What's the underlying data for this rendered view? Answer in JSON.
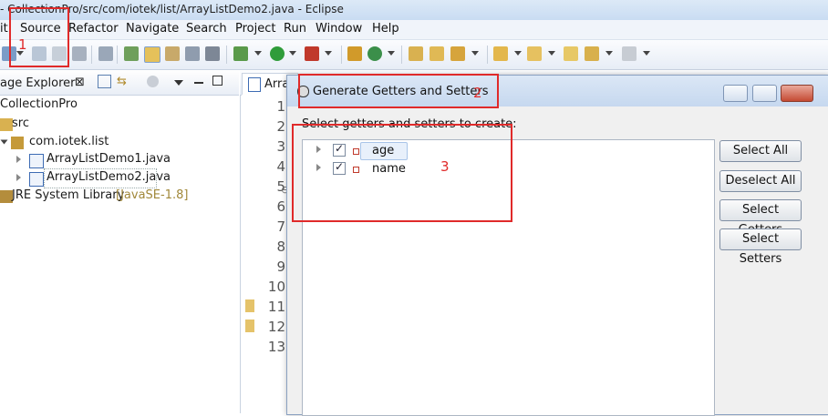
{
  "window": {
    "title": "- CollectionPro/src/com/iotek/list/ArrayListDemo2.java - Eclipse"
  },
  "menu": [
    "it",
    "Source",
    "Refactor",
    "Navigate",
    "Search",
    "Project",
    "Run",
    "Window",
    "Help"
  ],
  "explorer": {
    "title": "age Explorer",
    "project": "CollectionPro",
    "src": "src",
    "package": "com.iotek.list",
    "files": [
      "ArrayListDemo1.java",
      "ArrayListDemo2.java"
    ],
    "jre_label": "JRE System Library",
    "jre_version": "[JavaSE-1.8]"
  },
  "editor": {
    "tab_label": "Arra",
    "line_numbers": [
      "1",
      "2",
      "3",
      "4",
      "5",
      "6",
      "7",
      "8",
      "9",
      "10",
      "11",
      "12",
      "13"
    ]
  },
  "dialog": {
    "title": "Generate Getters and Setters",
    "prompt": "Select getters and setters to create:",
    "fields": [
      {
        "name": "age",
        "checked": true,
        "selected": true
      },
      {
        "name": "name",
        "checked": true,
        "selected": false
      }
    ],
    "buttons": [
      "Select All",
      "Deselect All",
      "Select Getters",
      "Select Setters"
    ]
  },
  "annotations": [
    "1",
    "2",
    "3"
  ],
  "colors": {
    "annotation": "#e02a2a",
    "selection": "#e8f0fb"
  }
}
